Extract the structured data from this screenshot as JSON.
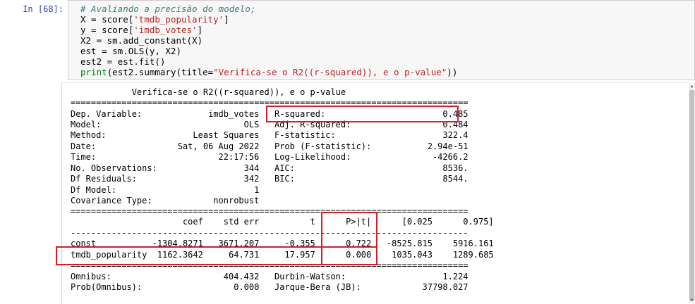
{
  "cell": {
    "prompt": "In [68]:",
    "code": {
      "comment": "# Avaliando a precisão do modelo;",
      "l2a": "X = score[",
      "l2s": "'tmdb_popularity'",
      "l2b": "]",
      "l3a": "y = score[",
      "l3s": "'imdb_votes'",
      "l3b": "]",
      "l4": "X2 = sm.add_constant(X)",
      "l5": "est = sm.OLS(y, X2)",
      "l6": "est2 = est.fit()",
      "l7fn": "print",
      "l7a": "(est2.summary(title=",
      "l7s": "\"Verifica-se o R2((r-squared)), e o p-value\"",
      "l7b": "))"
    }
  },
  "output": {
    "title": "            Verifica-se o R2((r-squared)), e o p-value",
    "sep_eq": "==============================================================================",
    "sep_dash": "------------------------------------------------------------------------------",
    "header_rows": [
      "Dep. Variable:             imdb_votes   R-squared:                       0.485",
      "Model:                            OLS   Adj. R-squared:                  0.484",
      "Method:                 Least Squares   F-statistic:                     322.4",
      "Date:                Sat, 06 Aug 2022   Prob (F-statistic):           2.94e-51",
      "Time:                        22:17:56   Log-Likelihood:                -4266.2",
      "No. Observations:                 344   AIC:                             8536.",
      "Df Residuals:                     342   BIC:                             8544.",
      "Df Model:                           1",
      "Covariance Type:            nonrobust"
    ],
    "coef_header": "                      coef    std err          t      P>|t|      [0.025      0.975]",
    "coef_rows": [
      "const           -1304.8271   3671.207     -0.355      0.722   -8525.815    5916.161",
      "tmdb_popularity  1162.3642     64.731     17.957      0.000    1035.043    1289.685"
    ],
    "diag_rows": [
      "Omnibus:                      404.432   Durbin-Watson:                   1.224",
      "Prob(Omnibus):                  0.000   Jarque-Bera (JB):            37798.027"
    ]
  }
}
